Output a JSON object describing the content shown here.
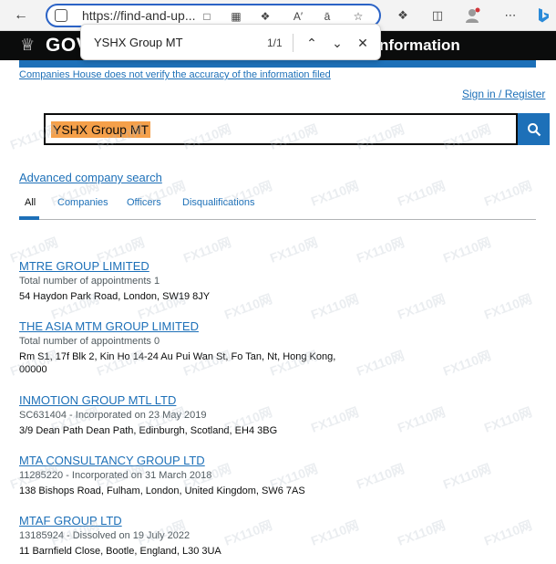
{
  "browser": {
    "url": "https://find-and-up...",
    "icons": [
      "back-arrow-icon",
      "info-icon",
      "reader-view-icon",
      "grid-icon",
      "extension-puzzle-icon",
      "read-aloud-icon",
      "translate-icon",
      "favorite-star-icon",
      "extensions-icon",
      "split-screen-icon",
      "profile-icon",
      "more-icon",
      "bing-icon"
    ]
  },
  "find_bar": {
    "query": "YSHX Group MT",
    "count": "1/1"
  },
  "header": {
    "logo": "GOV",
    "service": "nformation"
  },
  "disclaimer": "Companies House does not verify the accuracy of the information filed",
  "signin": "Sign in / Register",
  "search": {
    "value": "YSHX Group MT"
  },
  "advanced_search": "Advanced company search",
  "tabs": [
    {
      "label": "All",
      "active": true
    },
    {
      "label": "Companies",
      "active": false
    },
    {
      "label": "Officers",
      "active": false
    },
    {
      "label": "Disqualifications",
      "active": false
    }
  ],
  "results": [
    {
      "title": "MTRE GROUP LIMITED",
      "meta": "Total number of appointments 1",
      "address": "54 Haydon Park Road, London, SW19 8JY"
    },
    {
      "title": "THE ASIA MTM GROUP LIMITED",
      "meta": "Total number of appointments 0",
      "address": "Rm S1, 17f Blk 2, Kin Ho 14-24 Au Pui Wan St, Fo Tan, Nt, Hong Kong, 00000"
    },
    {
      "title": "INMOTION GROUP MTL LTD",
      "meta": "SC631404 - Incorporated on 23 May 2019",
      "address": "3/9 Dean Path Dean Path, Edinburgh, Scotland, EH4 3BG"
    },
    {
      "title": "MTA CONSULTANCY GROUP LTD",
      "meta": "11285220 - Incorporated on 31 March 2018",
      "address": "138 Bishops Road, Fulham, London, United Kingdom, SW6 7AS"
    },
    {
      "title": "MTAF GROUP LTD",
      "meta": "13185924 - Dissolved on 19 July 2022",
      "address": "11 Barnfield Close, Bootle, England, L30 3UA"
    }
  ],
  "watermark": "FX110网",
  "colors": {
    "link": "#1d70b8",
    "header": "#0b0c0c",
    "highlight": "#f5a04a"
  }
}
